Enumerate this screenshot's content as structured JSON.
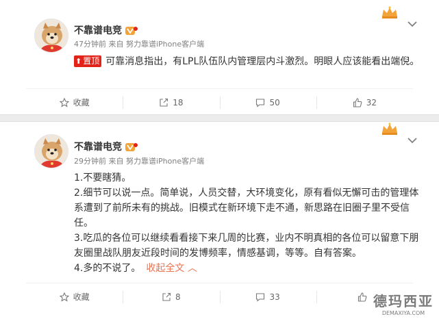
{
  "posts": [
    {
      "author": "不靠谱电竞",
      "meta": "47分钟前 来自 努力靠谱iPhone客户端",
      "pin_label": "置顶",
      "text": "可靠消息指出，有LPL队伍队内管理层内斗激烈。明眼人应该能看出端倪。",
      "actions": {
        "favorite": "收藏",
        "repost": "18",
        "comment": "50",
        "like": "32"
      }
    },
    {
      "author": "不靠谱电竞",
      "meta": "29分钟前 来自 努力靠谱iPhone客户端",
      "lines": [
        "1.不要瞎猜。",
        "2.细节可以说一点。简单说，人员交替，大环境变化，原有看似无懈可击的管理体系遭到了前所未有的挑战。旧模式在新环境下走不通，新思路在旧圈子里不受信任。",
        "3.吃瓜的各位可以继续看看接下来几周的比赛，业内不明真相的各位可以留意下朋友圈里战队朋友近段时间的发博频率，情感基调，等等。自有答案。",
        "4.多的不说了。"
      ],
      "collapse_label": "收起全文",
      "actions": {
        "favorite": "收藏",
        "repost": "8",
        "comment": "33",
        "like": ""
      }
    }
  ],
  "watermark": {
    "title": "德玛西亚",
    "url": "DEMAXIYA.COM"
  },
  "colors": {
    "accent": "#eb7350",
    "pin": "#e2231a",
    "crown": "#f2a33a"
  }
}
